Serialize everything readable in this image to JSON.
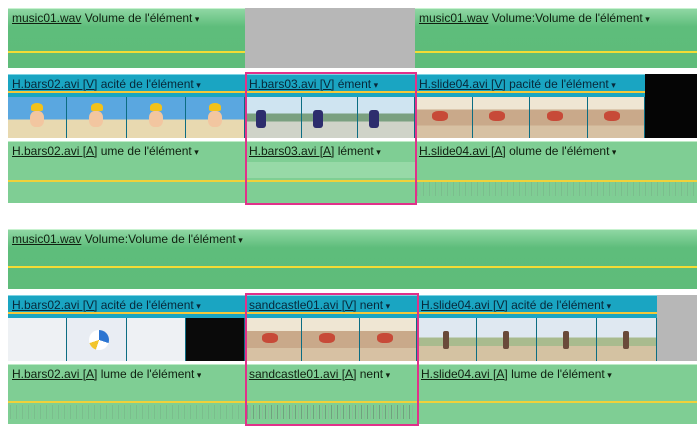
{
  "top": {
    "music_left": {
      "name": "music01.wav",
      "effect": "Volume de l'élément"
    },
    "music_right": {
      "name": "music01.wav",
      "effect": "Volume:Volume de l'élément"
    },
    "video": [
      {
        "name": "H.bars02.avi [V]",
        "effect": "acité de l'élément"
      },
      {
        "name": "H.bars03.avi [V]",
        "effect": "ément"
      },
      {
        "name": "H.slide04.avi [V]",
        "effect": "pacité de l'élément"
      }
    ],
    "audio": [
      {
        "name": "H.bars02.avi [A]",
        "effect": "ume de l'élément"
      },
      {
        "name": "H.bars03.avi [A]",
        "effect": "lément"
      },
      {
        "name": "H.slide04.avi [A]",
        "effect": "olume de l'élément"
      }
    ]
  },
  "bottom": {
    "music": {
      "name": "music01.wav",
      "effect": "Volume:Volume de l'élément"
    },
    "video": [
      {
        "name": "H.bars02.avi [V]",
        "effect": "acité de l'élément"
      },
      {
        "name": "sandcastle01.avi [V]",
        "effect": "nent"
      },
      {
        "name": "H.slide04.avi [V]",
        "effect": "acité de l'élément"
      }
    ],
    "audio": [
      {
        "name": "H.bars02.avi [A]",
        "effect": "lume de l'élément"
      },
      {
        "name": "sandcastle01.avi [A]",
        "effect": "nent"
      },
      {
        "name": "H.slide04.avi [A]",
        "effect": "lume de l'élément"
      }
    ]
  },
  "colors": {
    "highlight": "#e1318a",
    "audio_clip": "#7fce94",
    "video_clip": "#1aa5c2",
    "volume_line": "#f4dc34"
  }
}
